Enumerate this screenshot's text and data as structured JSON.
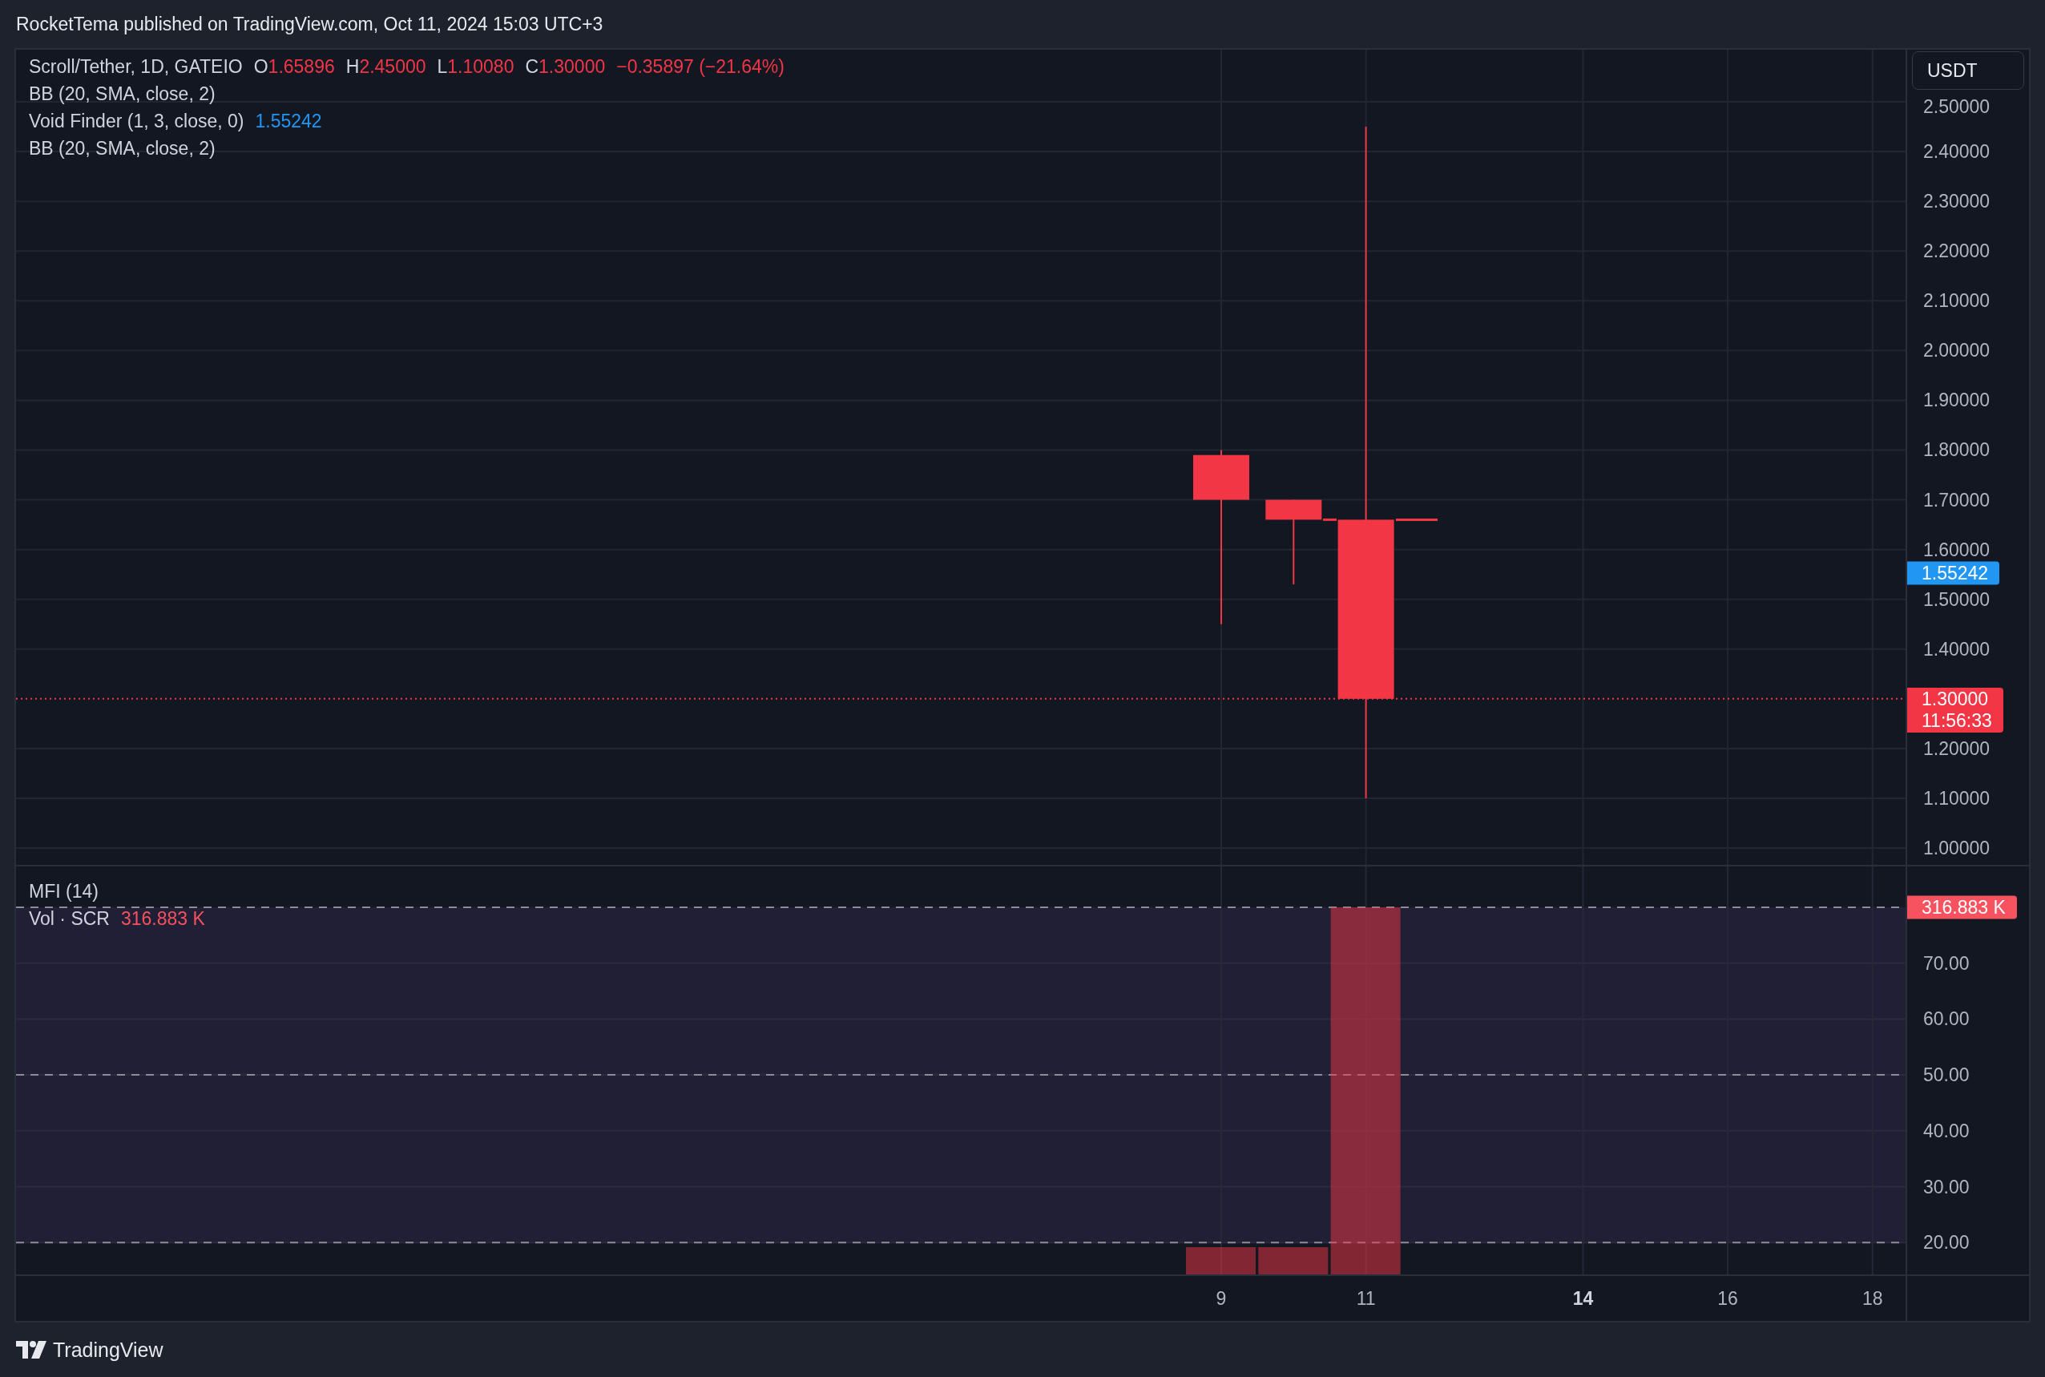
{
  "header": {
    "text": "RocketTema published on TradingView.com, Oct 11, 2024 15:03 UTC+3"
  },
  "legend": {
    "symbol": "Scroll/Tether, 1D, GATEIO",
    "ohlc": [
      {
        "key": "O",
        "value": "1.65896"
      },
      {
        "key": "H",
        "value": "2.45000"
      },
      {
        "key": "L",
        "value": "1.10080"
      },
      {
        "key": "C",
        "value": "1.30000"
      }
    ],
    "change": "−0.35897 (−21.64%)",
    "indicators": [
      {
        "name": "BB (20, SMA, close, 2)"
      },
      {
        "name": "Void Finder (1, 3, close, 0)",
        "value": "1.55242"
      },
      {
        "name": "BB (20, SMA, close, 2)"
      }
    ]
  },
  "price_axis": {
    "currency": "USDT",
    "ticks": [
      "2.50000",
      "2.40000",
      "2.30000",
      "2.20000",
      "2.10000",
      "2.00000",
      "1.90000",
      "1.80000",
      "1.70000",
      "1.60000",
      "1.50000",
      "1.40000",
      "1.20000",
      "1.10000",
      "1.00000"
    ],
    "markers": [
      {
        "kind": "indicator",
        "value": "1.55242"
      },
      {
        "kind": "last",
        "value": "1.30000",
        "countdown": "11:56:33"
      }
    ]
  },
  "lower_pane": {
    "legend": [
      {
        "name": "MFI (14)"
      },
      {
        "name": "Vol · SCR",
        "value": "316.883 K"
      }
    ],
    "ticks": [
      "70.00",
      "60.00",
      "50.00",
      "40.00",
      "30.00",
      "20.00"
    ],
    "volume_marker": "316.883 K"
  },
  "time_axis": [
    {
      "label": "9",
      "bold": false
    },
    {
      "label": "11",
      "bold": false
    },
    {
      "label": "14",
      "bold": true
    },
    {
      "label": "16",
      "bold": false
    },
    {
      "label": "18",
      "bold": false
    }
  ],
  "footer": {
    "brand": "TradingView"
  }
}
